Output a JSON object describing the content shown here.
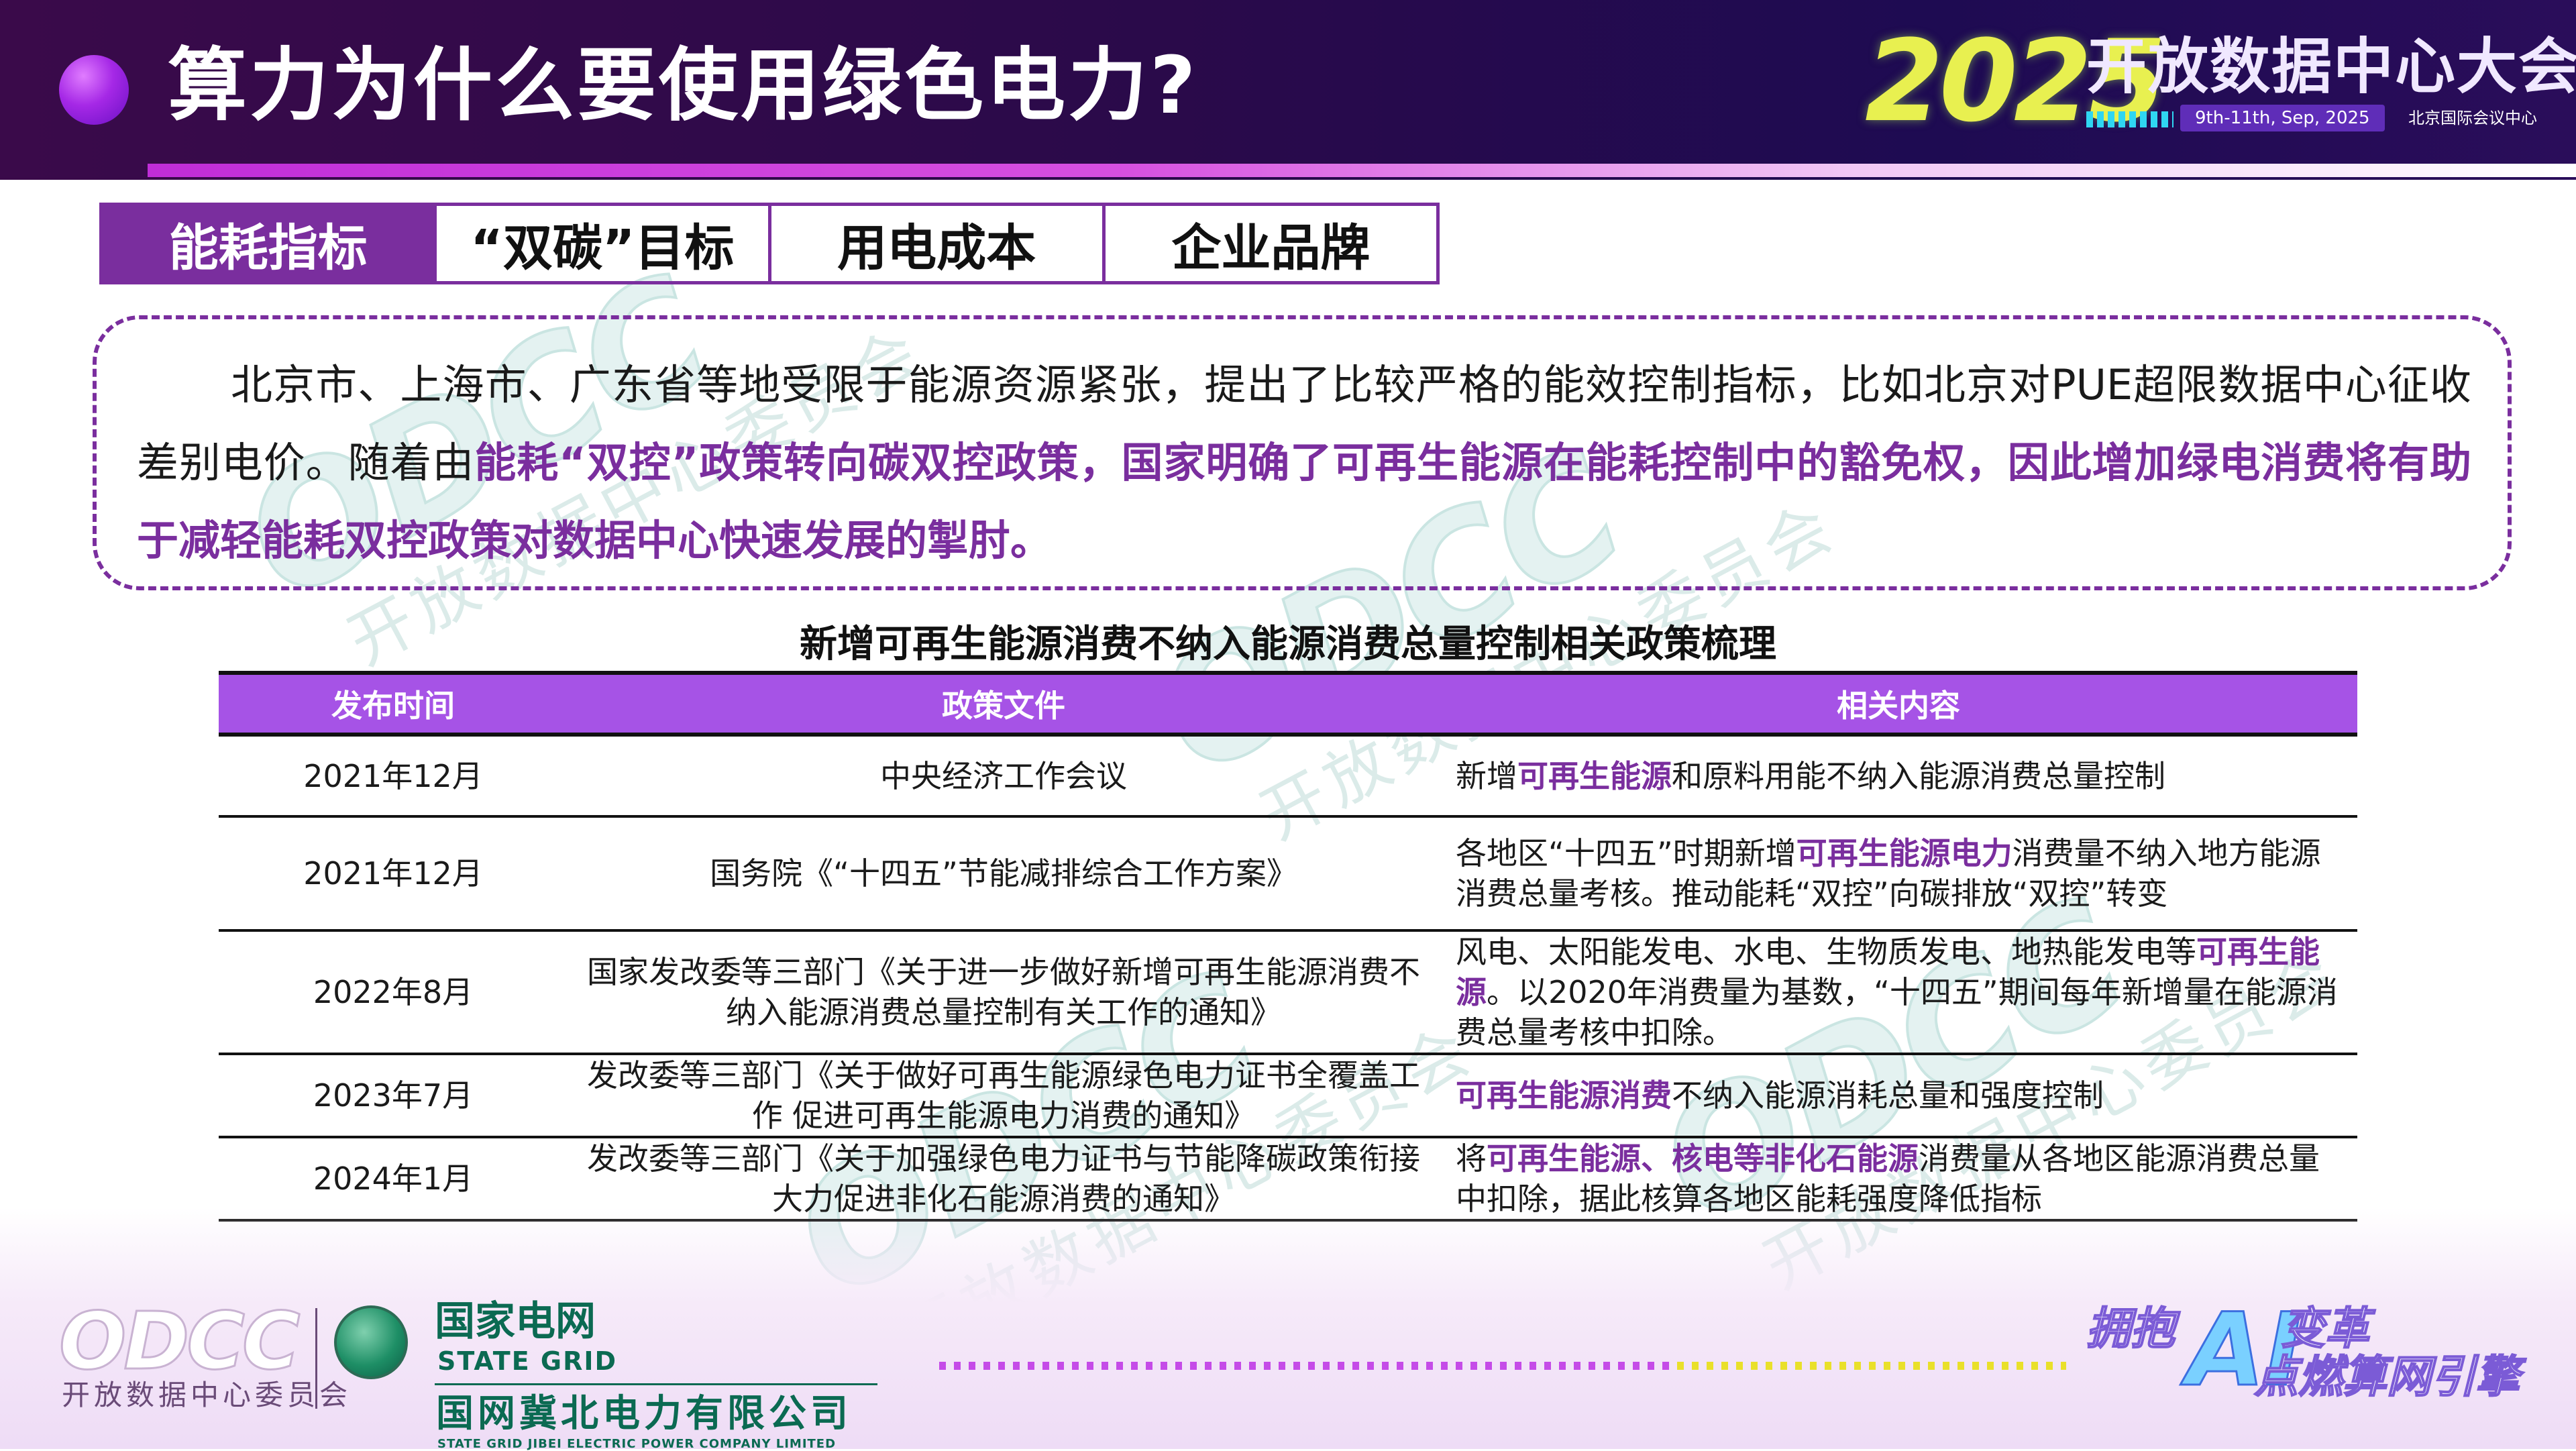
{
  "header": {
    "title": "算力为什么要使用绿色电力?",
    "event_year": "2025",
    "event_name": "开放数据中心大会",
    "event_date": "9th-11th, Sep, 2025",
    "event_venue": "北京国际会议中心"
  },
  "tabs": [
    {
      "label": "能耗指标",
      "active": true
    },
    {
      "label": "“双碳”目标",
      "active": false
    },
    {
      "label": "用电成本",
      "active": false
    },
    {
      "label": "企业品牌",
      "active": false
    }
  ],
  "paragraph": {
    "normal_1": "北京市、上海市、广东省等地受限于能源资源紧张，提出了比较严格的能效控制指标，比如北京对PUE超限数据中心征收差别电价。随着由",
    "highlight_1": "能耗“双控”政策转向碳双控政策，国家明确了可再生能源在能耗控制中的豁免权，因此增加绿电消费将有助于减轻能耗双控政策对数据中心快速发展的掣肘。"
  },
  "table": {
    "title": "新增可再生能源消费不纳入能源消费总量控制相关政策梳理",
    "headers": [
      "发布时间",
      "政策文件",
      "相关内容"
    ],
    "rows": [
      {
        "date": "2021年12月",
        "doc": "中央经济工作会议",
        "content": [
          {
            "t": "新增",
            "hl": false
          },
          {
            "t": "可再生能源",
            "hl": true
          },
          {
            "t": "和原料用能不纳入能源消费总量控制",
            "hl": false
          }
        ]
      },
      {
        "date": "2021年12月",
        "doc": "国务院《“十四五”节能减排综合工作方案》",
        "content": [
          {
            "t": "各地区“十四五”时期新增",
            "hl": false
          },
          {
            "t": "可再生能源电力",
            "hl": true
          },
          {
            "t": "消费量不纳入地方能源消费总量考核。推动能耗“双控”向碳排放“双控”转变",
            "hl": false
          }
        ]
      },
      {
        "date": "2022年8月",
        "doc": "国家发改委等三部门《关于进一步做好新增可再生能源消费不纳入能源消费总量控制有关工作的通知》",
        "content": [
          {
            "t": "风电、太阳能发电、水电、生物质发电、地热能发电等",
            "hl": false
          },
          {
            "t": "可再生能源",
            "hl": true
          },
          {
            "t": "。以2020年消费量为基数，“十四五”期间每年新增量在能源消费总量考核中扣除。",
            "hl": false
          }
        ]
      },
      {
        "date": "2023年7月",
        "doc": "发改委等三部门《关于做好可再生能源绿色电力证书全覆盖工作 促进可再生能源电力消费的通知》",
        "content": [
          {
            "t": "可再生能源消费",
            "hl": true
          },
          {
            "t": "不纳入能源消耗总量和强度控制",
            "hl": false
          }
        ]
      },
      {
        "date": "2024年1月",
        "doc": "发改委等三部门《关于加强绿色电力证书与节能降碳政策衔接大力促进非化石能源消费的通知》",
        "content": [
          {
            "t": "将",
            "hl": false
          },
          {
            "t": "可再生能源、核电等非化石能源",
            "hl": true
          },
          {
            "t": "消费量从各地区能源消费总量中扣除，据此核算各地区能耗强度降低指标",
            "hl": false
          }
        ]
      }
    ]
  },
  "watermark": {
    "logo": "ODCC",
    "text": "开放数据中心委员会"
  },
  "footer": {
    "odcc_logo": "ODCC",
    "odcc_sub": "开放数据中心委员会",
    "sg_cn": "国家电网",
    "sg_en": "STATE GRID",
    "jb_cn": "国网冀北电力有限公司",
    "jb_en": "STATE GRID JIBEI ELECTRIC POWER COMPANY LIMITED",
    "slogan_a": "拥抱",
    "slogan_ai": "AI",
    "slogan_b": "变革",
    "slogan_c": "点燃算网引擎"
  },
  "colors": {
    "accent": "#7a2e9e",
    "table_header": "#a653e6",
    "header_bg": "#2a0a4a"
  }
}
